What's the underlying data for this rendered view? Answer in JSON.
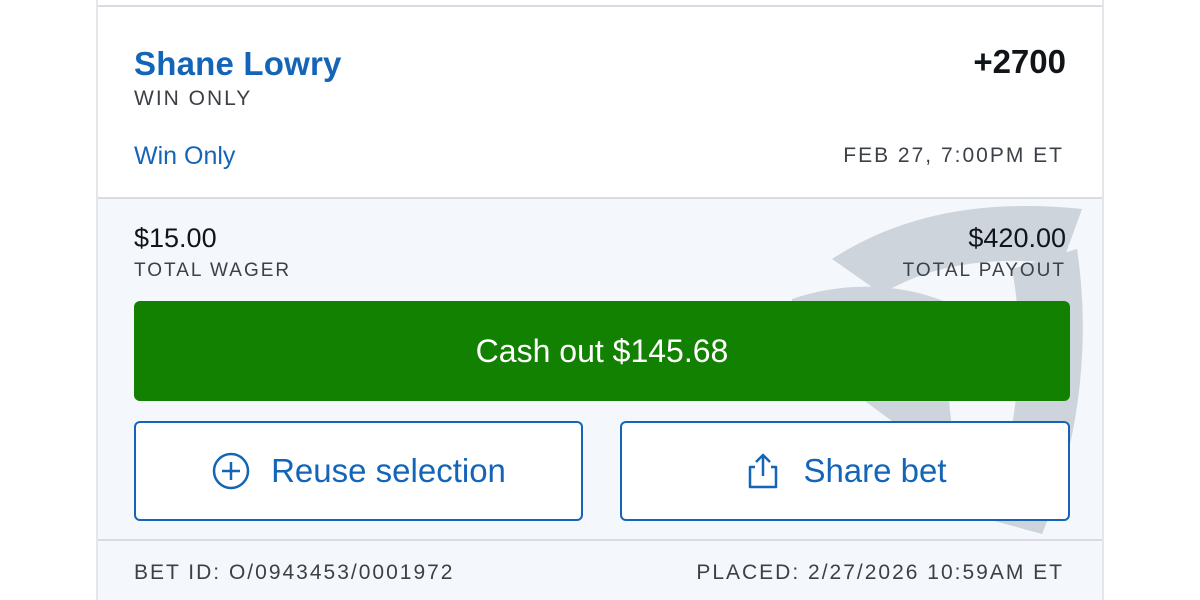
{
  "bet": {
    "runner_name": "Shane Lowry",
    "odds": "+2700",
    "market_type": "WIN ONLY",
    "market_link": "Win Only",
    "event_time": "FEB 27, 7:00PM ET"
  },
  "wager": {
    "total_wager_amount": "$15.00",
    "total_wager_label": "TOTAL WAGER",
    "total_payout_amount": "$420.00",
    "total_payout_label": "TOTAL PAYOUT"
  },
  "actions": {
    "cashout_label": "Cash out $145.68",
    "reuse_label": "Reuse selection",
    "reuse_icon": "plus-circle-icon",
    "share_label": "Share bet",
    "share_icon": "share-icon"
  },
  "footer": {
    "bet_id": "BET ID: O/0943453/0001972",
    "placed": "PLACED: 2/27/2026 10:59AM ET"
  },
  "colors": {
    "brand_blue": "#1465b8",
    "cashout_green": "#128000",
    "panel_background": "#f4f7fb"
  }
}
